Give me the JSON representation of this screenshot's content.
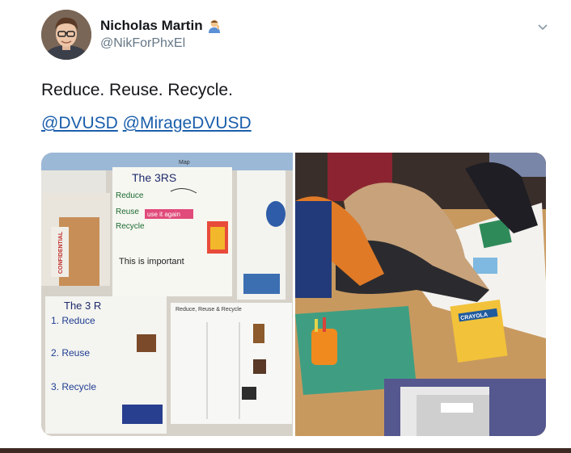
{
  "author": {
    "display_name": "Nicholas Martin",
    "handle": "@NikForPhxEl",
    "badge_icon": "person-emoji-icon"
  },
  "tweet": {
    "text": "Reduce. Reuse. Recycle.",
    "mentions": [
      "@DVUSD",
      "@MirageDVUSD"
    ]
  },
  "photos": {
    "left": {
      "poster_title": "The 3RS",
      "poster_lines": [
        "Reduce",
        "Reuse",
        "Recycle",
        "use it again",
        "This is important"
      ],
      "sign_text": "CONFIDENTIAL",
      "chart_title": "The 3 R",
      "chart_items": [
        "1. Reduce",
        "2. Reuse",
        "3. Recycle"
      ],
      "middle_chart_title": "Reduce, Reuse & Recycle",
      "map_label": "Map"
    },
    "right": {
      "marker_box_text": "CRAYOLA"
    }
  },
  "colors": {
    "link": "#1b5eab",
    "handle": "#657786",
    "bottom_bar": "#3d2a22"
  }
}
